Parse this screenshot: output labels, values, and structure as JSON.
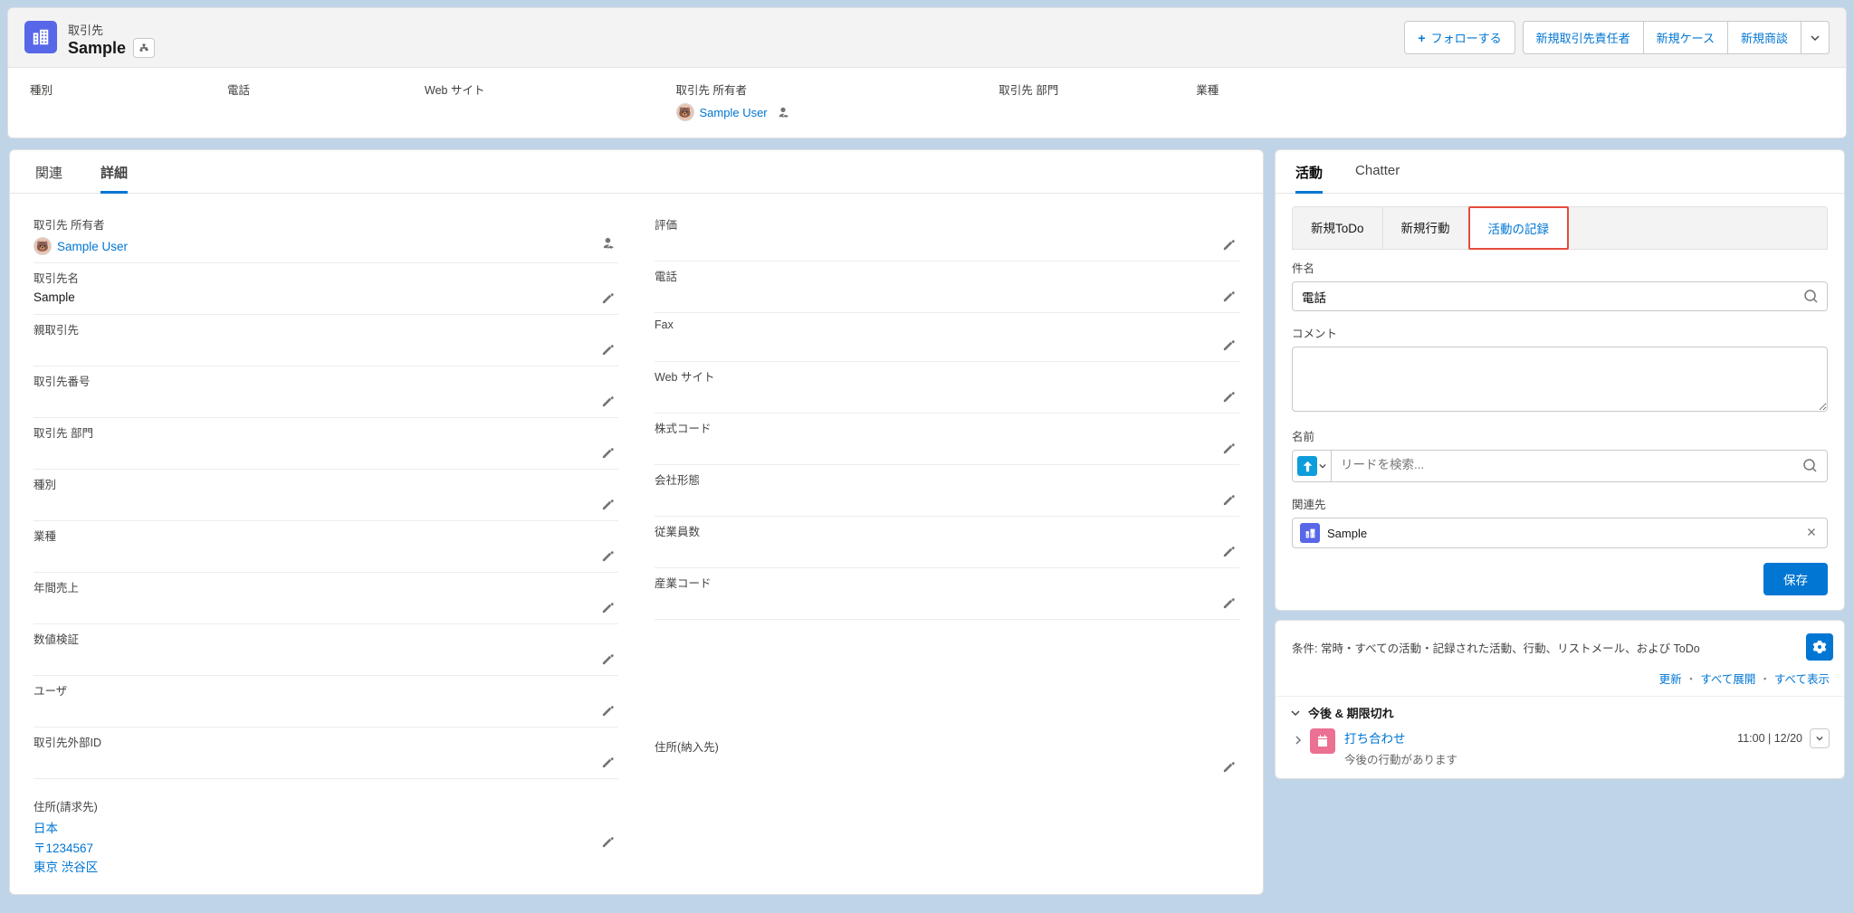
{
  "header": {
    "object_label": "取引先",
    "record_name": "Sample",
    "follow_label": "フォローする",
    "new_contact_label": "新規取引先責任者",
    "new_case_label": "新規ケース",
    "new_opp_label": "新規商談"
  },
  "highlights": {
    "type_label": "種別",
    "phone_label": "電話",
    "website_label": "Web サイト",
    "owner_label": "取引先 所有者",
    "owner_name": "Sample User",
    "dept_label": "取引先 部門",
    "industry_label": "業種"
  },
  "tabs": {
    "related": "関連",
    "detail": "詳細"
  },
  "detail": {
    "left": {
      "owner_label": "取引先 所有者",
      "owner_value": "Sample User",
      "name_label": "取引先名",
      "name_value": "Sample",
      "parent_label": "親取引先",
      "number_label": "取引先番号",
      "dept_label": "取引先 部門",
      "type_label": "種別",
      "industry_label": "業種",
      "revenue_label": "年間売上",
      "numval_label": "数値検証",
      "user_label": "ユーザ",
      "external_id_label": "取引先外部ID",
      "billing_addr_label": "住所(請求先)",
      "addr_country": "日本",
      "addr_zip": "〒1234567",
      "addr_city": "東京 渋谷区"
    },
    "right": {
      "rating_label": "評価",
      "phone_label": "電話",
      "fax_label": "Fax",
      "website_label": "Web サイト",
      "ticker_label": "株式コード",
      "ownership_label": "会社形態",
      "employees_label": "従業員数",
      "sic_label": "産業コード",
      "shipping_addr_label": "住所(納入先)"
    }
  },
  "activity": {
    "tab_activity": "活動",
    "tab_chatter": "Chatter",
    "subtab_todo": "新規ToDo",
    "subtab_event": "新規行動",
    "subtab_log": "活動の記録",
    "subject_label": "件名",
    "subject_value": "電話",
    "comment_label": "コメント",
    "name_label": "名前",
    "name_placeholder": "リードを検索...",
    "related_label": "関連先",
    "related_value": "Sample",
    "save_label": "保存",
    "filter_text": "条件: 常時・すべての活動・記録された活動、行動、リストメール、および ToDo",
    "link_refresh": "更新",
    "link_expand": "すべて展開",
    "link_viewall": "すべて表示",
    "timeline_header": "今後 & 期限切れ",
    "item_title": "打ち合わせ",
    "item_sub": "今後の行動があります",
    "item_time": "11:00 | 12/20"
  }
}
